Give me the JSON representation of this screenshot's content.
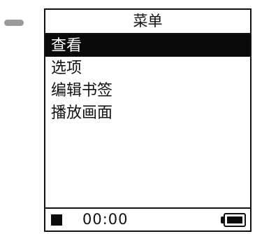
{
  "device": {
    "indicator_icon": "status-led-icon",
    "indicator_color": "#9a9a9a"
  },
  "header": {
    "title": "菜单"
  },
  "menu": {
    "items": [
      {
        "label": "查看",
        "selected": true
      },
      {
        "label": "选项",
        "selected": false
      },
      {
        "label": "编辑书签",
        "selected": false
      },
      {
        "label": "播放画面",
        "selected": false
      }
    ],
    "selection_color": "#0a0a0a"
  },
  "status_bar": {
    "state_icon": "stop-icon",
    "time": "00:00",
    "battery_icon": "battery-icon",
    "battery_level": 1.0
  }
}
